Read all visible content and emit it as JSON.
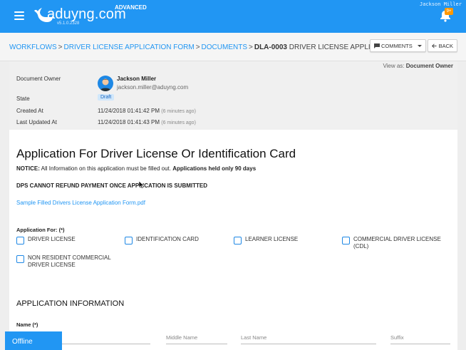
{
  "app": {
    "brand": "aduyng.com",
    "edition": "ADVANCED",
    "version": "v5.1.0.2328",
    "user_top": "Jackson Miller",
    "notification_count": "9+",
    "accent": "#2196f3"
  },
  "breadcrumb": {
    "items": [
      "WORKFLOWS",
      "DRIVER LICENSE APPLICATION FORM",
      "DOCUMENTS"
    ],
    "sep": ">",
    "current_id": "DLA-0003",
    "current_title": "DRIVER LICENSE APPLICAT..."
  },
  "toolbar": {
    "comments_label": "COMMENTS",
    "back_label": "BACK"
  },
  "meta": {
    "view_as_prefix": "View as:",
    "view_as_value": "Document Owner",
    "owner_label": "Document Owner",
    "owner_name": "Jackson Miller",
    "owner_email": "jackson.miller@aduyng.com",
    "state_label": "State",
    "state_value": "Draft",
    "created_label": "Created At",
    "created_value": "11/24/2018 01:41:42 PM",
    "created_rel": "(6 minutes ago)",
    "updated_label": "Last Updated At",
    "updated_value": "11/24/2018 01:41:43 PM",
    "updated_rel": "(6 minutes ago)"
  },
  "form": {
    "title": "Application For Driver License Or Identification Card",
    "notice_prefix": "NOTICE:",
    "notice_text": "All Information on this application must be filled out.",
    "notice_bold": "Applications held only 90 days",
    "dps_notice": "DPS CANNOT REFUND PAYMENT ONCE APPLICATION IS SUBMITTED",
    "pdf_link": "Sample Filled Drivers License Application Form.pdf",
    "application_for_label": "Application For: (*)",
    "options": [
      "DRIVER LICENSE",
      "IDENTIFICATION CARD",
      "LEARNER LICENSE",
      "COMMERCIAL DRIVER LICENSE (CDL)",
      "NON RESIDENT COMMERCIAL DRIVER LICENSE"
    ],
    "section_title": "APPLICATION INFORMATION",
    "name_label": "Name (*)",
    "name_fields": {
      "middle": "Middle Name",
      "last": "Last Name",
      "suffix": "Suffix"
    }
  },
  "status": {
    "offline": "Offline"
  }
}
